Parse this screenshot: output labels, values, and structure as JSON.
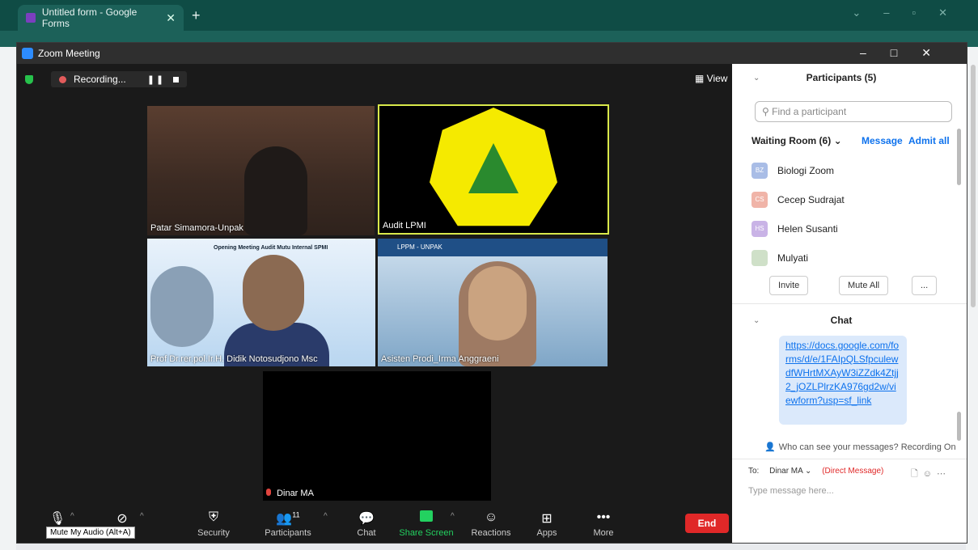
{
  "browser": {
    "tab_title": "Untitled form - Google Forms",
    "tab_close": "✕",
    "new_tab": "+"
  },
  "zoom": {
    "window_title": "Zoom Meeting",
    "recording_label": "Recording...",
    "view_label": "View",
    "tiles": {
      "patar": "Patar Simamora-Unpak",
      "audit": "Audit LPMI",
      "prof": "Prof Dr.rer.pol.Ir.H. Didik Notosudjono Msc",
      "asisten": "Asisten Prodi_Irma Anggraeni",
      "dinar": "Dinar MA",
      "prof_banner": "Opening Meeting Audit Mutu Internal SPMI",
      "asisten_banner": "LPPM - UNPAK"
    },
    "toolbar": {
      "mute_tooltip": "Mute My Audio (Alt+A)",
      "security": "Security",
      "participants": "Participants",
      "participants_count": "11",
      "chat": "Chat",
      "share_screen": "Share Screen",
      "reactions": "Reactions",
      "apps": "Apps",
      "more": "More",
      "end": "End"
    }
  },
  "participants_panel": {
    "title": "Participants (5)",
    "search_placeholder": "Find a participant",
    "waiting_room": "Waiting Room (6)",
    "message": "Message",
    "admit_all": "Admit all",
    "waiting": [
      {
        "initials": "BZ",
        "name": "Biologi Zoom",
        "color": "#a9bde6"
      },
      {
        "initials": "CS",
        "name": "Cecep Sudrajat",
        "color": "#f0b4a8"
      },
      {
        "initials": "HS",
        "name": "Helen Susanti",
        "color": "#c9b3e6"
      },
      {
        "initials": "",
        "name": "Mulyati",
        "color": "#cfe0c8"
      }
    ],
    "invite": "Invite",
    "mute_all": "Mute All",
    "more": "..."
  },
  "chat_panel": {
    "title": "Chat",
    "link": "https://docs.google.com/forms/d/e/1FAIpQLSfpculewdfWHrtMXAyW3iZZdk4Ztjj2_jOZLPlrzKA976gd2w/viewform?usp=sf_link",
    "who_can_see": "Who can see your messages? Recording On",
    "to_label": "To:",
    "to_recipient": "Dinar MA",
    "direct_message": "(Direct Message)",
    "input_placeholder": "Type message here..."
  }
}
